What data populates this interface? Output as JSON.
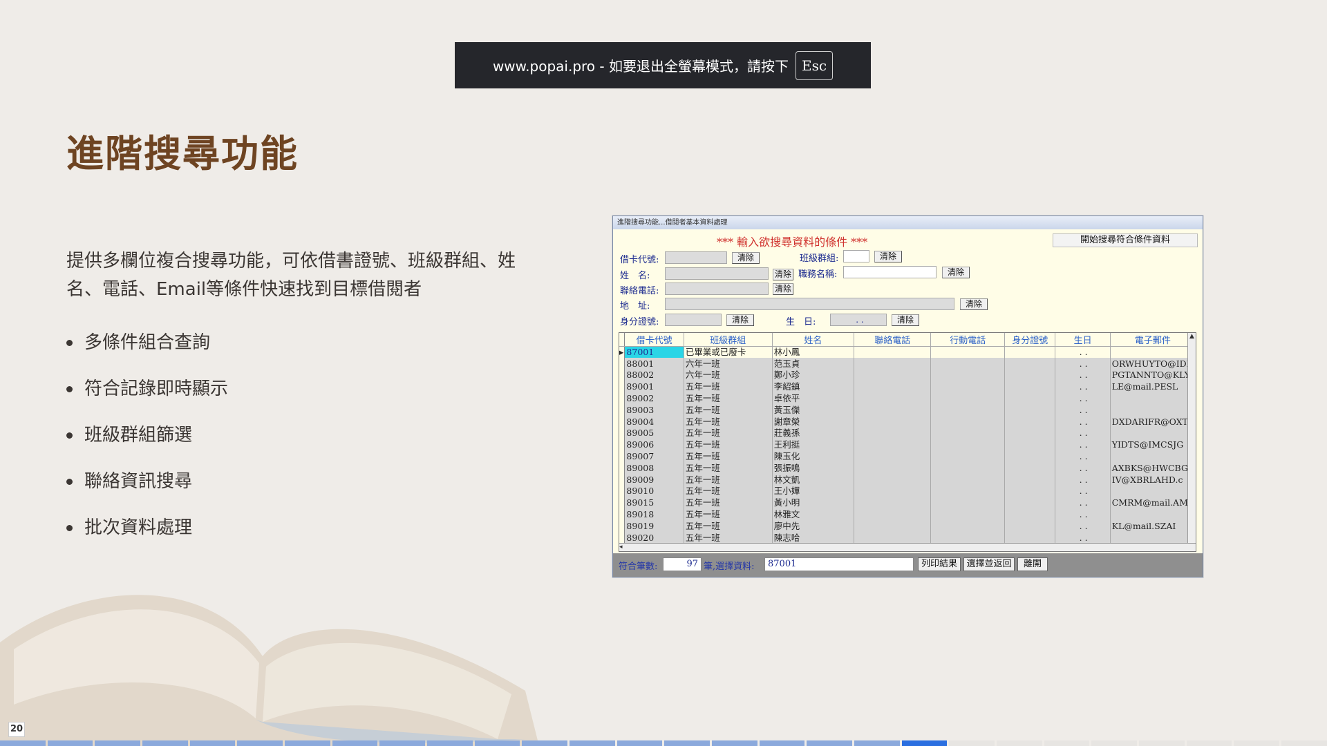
{
  "notice": {
    "text": "www.popai.pro - 如要退出全螢幕模式，請按下",
    "key": "Esc"
  },
  "slide": {
    "title": "進階搜尋功能",
    "description": "提供多欄位複合搜尋功能，可依借書證號、班級群組、姓名、電話、Email等條件快速找到目標借閱者",
    "bullets": [
      "多條件組合查詢",
      "符合記錄即時顯示",
      "班級群組篩選",
      "聯絡資訊搜尋",
      "批次資料處理"
    ],
    "page_number": "20",
    "progress": {
      "total_segments": 28,
      "current_segment": 20
    }
  },
  "app": {
    "title": "進階搜尋功能...借閱者基本資料處理",
    "heading": "*** 輸入欲搜尋資料的條件 ***",
    "start_search": "開始搜尋符合條件資料",
    "clear": "清除",
    "labels": {
      "card_no": "借卡代號:",
      "class_group": "班級群組:",
      "name": "姓　名:",
      "job_title": "職務名稱:",
      "phone": "聯絡電話:",
      "address": "地　址:",
      "id_no": "身分證號:",
      "birthday": "生　日:"
    },
    "birthday_value": ". .",
    "grid": {
      "columns": [
        "借卡代號",
        "班級群組",
        "姓名",
        "聯絡電話",
        "行動電話",
        "身分證號",
        "生日",
        "電子郵件"
      ],
      "rows": [
        [
          "87001",
          "已畢業或已廢卡",
          "林小鳳",
          "",
          "",
          "",
          ". .",
          ""
        ],
        [
          "88001",
          "六年一班",
          "范玉貞",
          "",
          "",
          "",
          ". .",
          "ORWHUYTO@IDL"
        ],
        [
          "88002",
          "六年一班",
          "鄭小珍",
          "",
          "",
          "",
          ". .",
          "PGTANNTO@KLY"
        ],
        [
          "89001",
          "五年一班",
          "李紹鎮",
          "",
          "",
          "",
          ". .",
          "LE@mail.PESL"
        ],
        [
          "89002",
          "五年一班",
          "卓依平",
          "",
          "",
          "",
          ". .",
          ""
        ],
        [
          "89003",
          "五年一班",
          "黃玉傑",
          "",
          "",
          "",
          ". .",
          ""
        ],
        [
          "89004",
          "五年一班",
          "謝章榮",
          "",
          "",
          "",
          ". .",
          "DXDARIFR@OXT"
        ],
        [
          "89005",
          "五年一班",
          "莊義孫",
          "",
          "",
          "",
          ". .",
          ""
        ],
        [
          "89006",
          "五年一班",
          "王利挺",
          "",
          "",
          "",
          ". .",
          "YIDTS@IMCSJG"
        ],
        [
          "89007",
          "五年一班",
          "陳玉化",
          "",
          "",
          "",
          ". .",
          ""
        ],
        [
          "89008",
          "五年一班",
          "張振鳴",
          "",
          "",
          "",
          ". .",
          "AXBKS@HWCBGG"
        ],
        [
          "89009",
          "五年一班",
          "林文凱",
          "",
          "",
          "",
          ". .",
          "IV@XBRLAHD.c"
        ],
        [
          "89010",
          "五年一班",
          "王小嬋",
          "",
          "",
          "",
          ". .",
          ""
        ],
        [
          "89015",
          "五年一班",
          "黃小明",
          "",
          "",
          "",
          ". .",
          "CMRM@mail.AM"
        ],
        [
          "89018",
          "五年一班",
          "林雅文",
          "",
          "",
          "",
          ". .",
          ""
        ],
        [
          "89019",
          "五年一班",
          "廖中先",
          "",
          "",
          "",
          ". .",
          "KL@mail.SZAI"
        ],
        [
          "89020",
          "五年一班",
          "陳志哈",
          "",
          "",
          "",
          ". .",
          ""
        ]
      ]
    },
    "status": {
      "count_label": "符合筆數:",
      "count": "97",
      "selected_label": "筆,選擇資料:",
      "selected": "87001",
      "print": "列印結果",
      "select_return": "選擇並返回",
      "leave": "離開"
    }
  }
}
